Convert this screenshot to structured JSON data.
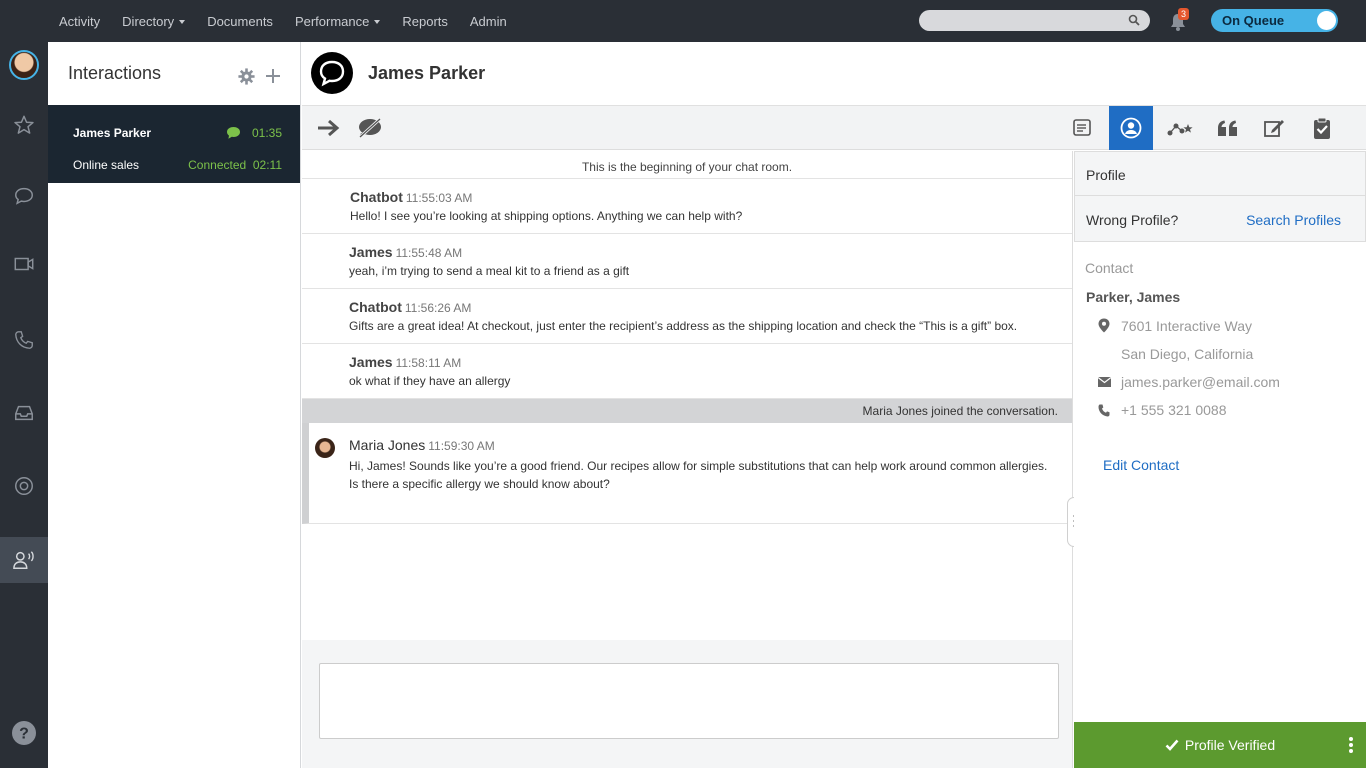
{
  "topnav": {
    "menu": [
      {
        "label": "Activity",
        "caret": false
      },
      {
        "label": "Directory",
        "caret": true
      },
      {
        "label": "Documents",
        "caret": false
      },
      {
        "label": "Performance",
        "caret": true
      },
      {
        "label": "Reports",
        "caret": false
      },
      {
        "label": "Admin",
        "caret": false
      }
    ],
    "search_placeholder": "",
    "notification_count": "3",
    "queue_status": "On Queue"
  },
  "rail": {
    "icons": [
      "avatar",
      "star-icon",
      "chat-icon",
      "video-icon",
      "phone-icon",
      "inbox-icon",
      "lifebuoy-icon",
      "agent-icon",
      "help-icon"
    ]
  },
  "interactions": {
    "title": "Interactions",
    "card": {
      "name": "James Parker",
      "timer": "01:35",
      "queue": "Online sales",
      "status": "Connected",
      "status_timer": "02:11"
    }
  },
  "chat": {
    "title": "James Parker",
    "beginning": "This is the beginning of your chat room.",
    "messages": [
      {
        "who": "Chatbot",
        "time": "11:55:03 AM",
        "text": "Hello! I see you’re looking at shipping options. Anything we can help with?"
      },
      {
        "who": "James",
        "time": "11:55:48 AM",
        "text": "yeah, i’m trying to send a meal kit to a friend as a gift"
      },
      {
        "who": "Chatbot",
        "time": "11:56:26 AM",
        "text": "Gifts are a great idea! At checkout, just enter the recipient’s address as the shipping location and check the “This is a gift” box."
      },
      {
        "who": "James",
        "time": "11:58:11 AM",
        "text": "ok what if they have an allergy"
      }
    ],
    "joined": "Maria Jones joined the conversation.",
    "agent_message": {
      "who": "Maria Jones",
      "time": "11:59:30 AM",
      "line1": "Hi, James! Sounds like you’re a good friend. Our recipes allow for simple substitutions that can help work around common allergies.",
      "line2": "Is there a specific allergy we should know about?"
    }
  },
  "profile": {
    "title": "Profile",
    "wrong": "Wrong Profile?",
    "search_link": "Search Profiles",
    "contact_label": "Contact",
    "name": "Parker, James",
    "address1": "7601 Interactive Way",
    "address2": "San Diego, California",
    "email": "james.parker@email.com",
    "phone": "+1 555 321 0088",
    "edit": "Edit Contact",
    "verified": "Profile Verified"
  },
  "colors": {
    "accent": "#1f6dc4",
    "green": "#5c9a2f",
    "nav": "#2a2f36"
  }
}
